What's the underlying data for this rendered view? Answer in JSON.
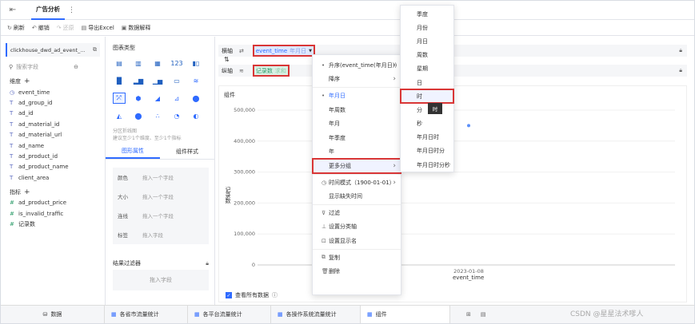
{
  "tab_title": "广告分析",
  "toolbar": {
    "refresh": "刷新",
    "undo": "撤销",
    "redo": "还原",
    "export": "导出Excel",
    "explain": "数据解释"
  },
  "left": {
    "dataset": "clickhouse_dwd_ad_event_...",
    "search_placeholder": "搜索字段",
    "dims_title": "维度",
    "measures_title": "指标",
    "dims": [
      "event_time",
      "ad_group_id",
      "ad_id",
      "ad_material_id",
      "ad_material_url",
      "ad_name",
      "ad_product_id",
      "ad_product_name",
      "client_area"
    ],
    "measures": [
      "ad_product_price",
      "is_invalid_traffic",
      "记录数"
    ]
  },
  "mid": {
    "chart_type_title": "图表类型",
    "hint1": "分区折线图",
    "hint2": "建议至少1个维度、至少1个指标",
    "tab_props": "图形属性",
    "tab_style": "组件样式",
    "props": [
      {
        "label": "颜色",
        "ph": "拖入一个字段"
      },
      {
        "label": "大小",
        "ph": "拖入一个字段"
      },
      {
        "label": "连线",
        "ph": "拖入一个字段"
      },
      {
        "label": "标签",
        "ph": "拖入字段"
      }
    ],
    "filter_title": "结果过滤器",
    "filter_ph": "拖入字段"
  },
  "axis": {
    "h_label": "横轴",
    "v_label": "纵轴",
    "h_field": "event_time",
    "h_field_tag": "年月日",
    "v_field": "记录数",
    "v_field_tag": "求和"
  },
  "chart": {
    "name": "组件",
    "ylabel": "记录数",
    "xlabel": "event_time",
    "checkbox": "查看所有数据"
  },
  "chart_data": {
    "type": "scatter",
    "x": [
      "2023-01-08"
    ],
    "series": [
      {
        "values": [
          450000
        ]
      }
    ],
    "ylim": [
      0,
      500000
    ],
    "yticks": [
      "0",
      "100,000",
      "200,000",
      "300,000",
      "400,000",
      "500,000"
    ],
    "grid": true
  },
  "menu1": {
    "items": [
      "升序(event_time(年月日))",
      "降序",
      "年月日",
      "年周数",
      "年月",
      "年季度",
      "年",
      "更多分组",
      "时间模式（1900-01-01）",
      "显示缺失时间",
      "过滤",
      "设置分类轴",
      "设置显示名",
      "复制",
      "删除"
    ]
  },
  "menu2": {
    "items": [
      "季度",
      "月份",
      "月日",
      "周数",
      "星期",
      "日",
      "时",
      "分",
      "秒",
      "年月日时",
      "年月日时分",
      "年月日时分秒"
    ],
    "tooltip": "时"
  },
  "bottom": {
    "data": "数据",
    "tabs": [
      "各省市流量统计",
      "各平台流量统计",
      "各操作系统流量统计",
      "组件"
    ]
  },
  "watermark": "CSDN @星星法术嗲人",
  "colors": {
    "accent": "#2f6bff",
    "highlight": "#d93636",
    "panel": "#f5f6f8"
  }
}
